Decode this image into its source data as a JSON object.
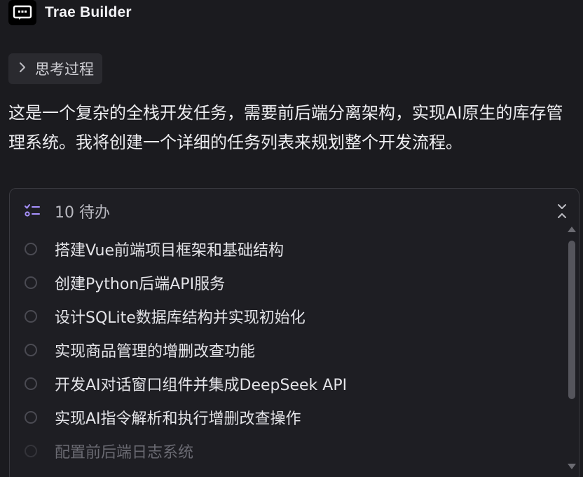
{
  "header": {
    "title": "Trae Builder",
    "avatar_icon": "robot-face-icon"
  },
  "thinking": {
    "label": "思考过程",
    "icon": "chevron-right-icon"
  },
  "message": {
    "text": "这是一个复杂的全栈开发任务，需要前后端分离架构，实现AI原生的库存管理系统。我将创建一个详细的任务列表来规划整个开发流程。"
  },
  "todo": {
    "count_label": "10 待办",
    "icon": "checklist-icon",
    "collapse_icon": "collapse-icon",
    "items": [
      {
        "text": "搭建Vue前端项目框架和基础结构"
      },
      {
        "text": "创建Python后端API服务"
      },
      {
        "text": "设计SQLite数据库结构并实现初始化"
      },
      {
        "text": "实现商品管理的增删改查功能"
      },
      {
        "text": "开发AI对话窗口组件并集成DeepSeek API"
      },
      {
        "text": "实现AI指令解析和执行增删改查操作"
      },
      {
        "text": "配置前后端日志系统"
      }
    ]
  },
  "colors": {
    "background": "#1b1b1f",
    "panel_border": "#3a3a40",
    "accent_icon": "#a892ff"
  }
}
